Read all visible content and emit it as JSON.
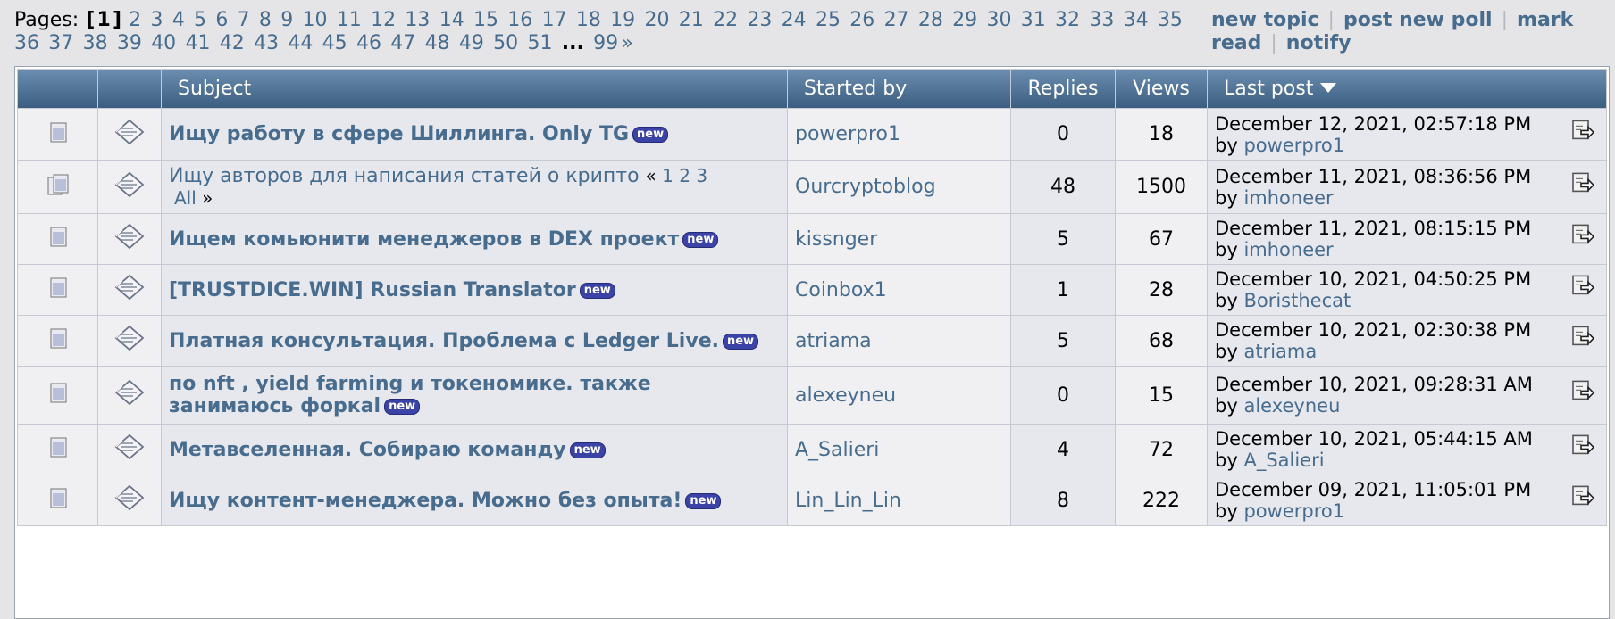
{
  "pagination": {
    "label": "Pages:",
    "current_open": "[",
    "current": "1",
    "current_close": "]",
    "pages": [
      "2",
      "3",
      "4",
      "5",
      "6",
      "7",
      "8",
      "9",
      "10",
      "11",
      "12",
      "13",
      "14",
      "15",
      "16",
      "17",
      "18",
      "19",
      "20",
      "21",
      "22",
      "23",
      "24",
      "25",
      "26",
      "27",
      "28",
      "29",
      "30",
      "31",
      "32",
      "33",
      "34",
      "35",
      "36",
      "37",
      "38",
      "39",
      "40",
      "41",
      "42",
      "43",
      "44",
      "45",
      "46",
      "47",
      "48",
      "49",
      "50",
      "51"
    ],
    "ellipsis": "...",
    "last_page": "99",
    "next": "»"
  },
  "actions": {
    "new_topic": "new topic",
    "post_new_poll": "post new poll",
    "mark_read": "mark read",
    "notify": "notify",
    "separator": "|"
  },
  "table": {
    "headers": {
      "subject": "Subject",
      "started_by": "Started by",
      "replies": "Replies",
      "views": "Views",
      "last_post": "Last post"
    },
    "new_badge": "new",
    "rows": [
      {
        "subject": "Ищу работу в сфере Шиллинга. Only TG",
        "bold": true,
        "new": true,
        "started_by": "powerpro1",
        "replies": "0",
        "views": "18",
        "last_post_date": "December 12, 2021, 02:57:18 PM",
        "by_label": "by",
        "last_post_by": "powerpro1"
      },
      {
        "subject": "Ищу авторов для написания статей о крипто",
        "bold": false,
        "new": false,
        "pages_open": "«",
        "pages": [
          "1",
          "2",
          "3"
        ],
        "pages_all": "All",
        "pages_close": "»",
        "started_by": "Ourcryptoblog",
        "replies": "48",
        "views": "1500",
        "last_post_date": "December 11, 2021, 08:36:56 PM",
        "by_label": "by",
        "last_post_by": "imhoneer"
      },
      {
        "subject": "Ищем комьюнити менеджеров в DEX проект",
        "bold": true,
        "new": true,
        "started_by": "kissnger",
        "replies": "5",
        "views": "67",
        "last_post_date": "December 11, 2021, 08:15:15 PM",
        "by_label": "by",
        "last_post_by": "imhoneer"
      },
      {
        "subject": "[TRUSTDICE.WIN] Russian Translator",
        "bold": true,
        "new": true,
        "started_by": "Coinbox1",
        "replies": "1",
        "views": "28",
        "last_post_date": "December 10, 2021, 04:50:25 PM",
        "by_label": "by",
        "last_post_by": "Boristhecat"
      },
      {
        "subject": "Платная консультация. Проблема с Ledger Live.",
        "bold": true,
        "new": true,
        "started_by": "atriama",
        "replies": "5",
        "views": "68",
        "last_post_date": "December 10, 2021, 02:30:38 PM",
        "by_label": "by",
        "last_post_by": "atriama"
      },
      {
        "subject": "по nft , yield farming и токеномике. также занимаюсь форкаl",
        "bold": true,
        "new": true,
        "started_by": "alexeyneu",
        "replies": "0",
        "views": "15",
        "last_post_date": "December 10, 2021, 09:28:31 AM",
        "by_label": "by",
        "last_post_by": "alexeyneu"
      },
      {
        "subject": "Метавселенная. Собираю команду",
        "bold": true,
        "new": true,
        "started_by": "A_Salieri",
        "replies": "4",
        "views": "72",
        "last_post_date": "December 10, 2021, 05:44:15 AM",
        "by_label": "by",
        "last_post_by": "A_Salieri"
      },
      {
        "subject": "Ищу контент-менеджера. Можно без опыта!",
        "bold": true,
        "new": true,
        "started_by": "Lin_Lin_Lin",
        "replies": "8",
        "views": "222",
        "last_post_date": "December 09, 2021, 11:05:01 PM",
        "by_label": "by",
        "last_post_by": "powerpro1"
      }
    ]
  }
}
